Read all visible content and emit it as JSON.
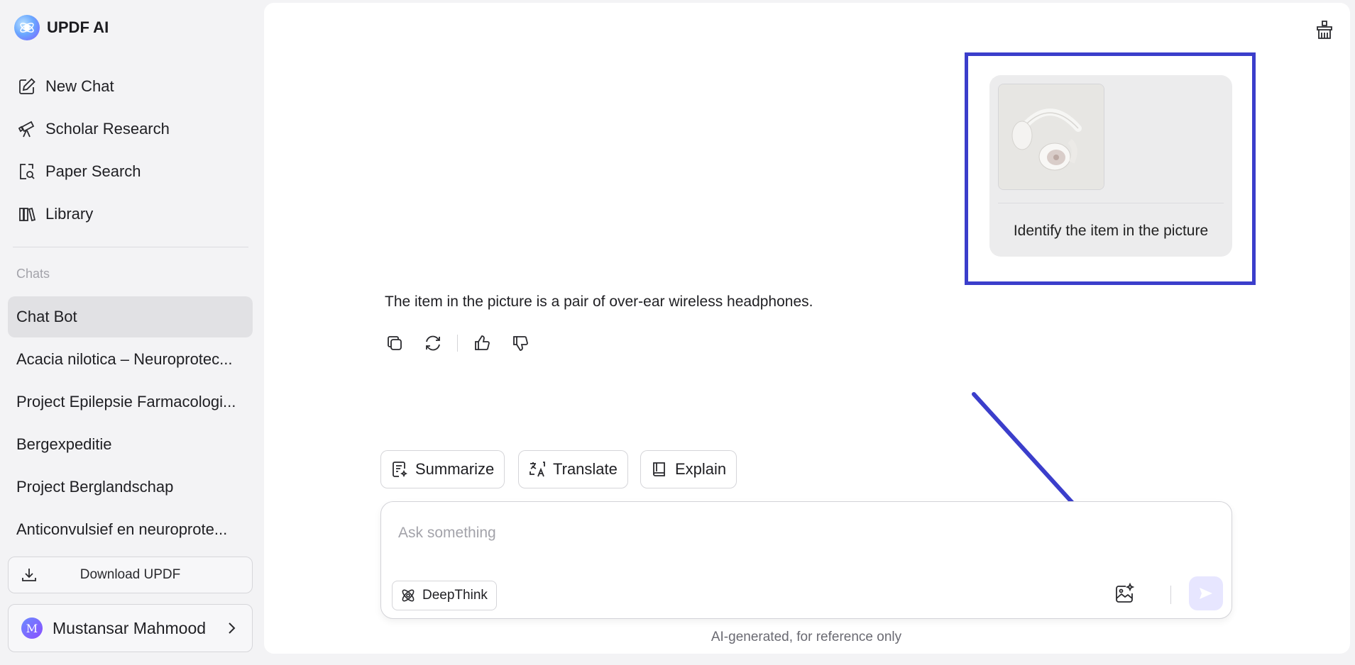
{
  "brand": {
    "name": "UPDF AI"
  },
  "sidebar": {
    "nav": [
      {
        "label": "New Chat",
        "icon": "edit-icon"
      },
      {
        "label": "Scholar Research",
        "icon": "telescope-icon"
      },
      {
        "label": "Paper Search",
        "icon": "document-search-icon"
      },
      {
        "label": "Library",
        "icon": "library-icon"
      }
    ],
    "chats_label": "Chats",
    "chats": [
      {
        "label": "Chat Bot",
        "active": true
      },
      {
        "label": "Acacia nilotica – Neuroprotec...",
        "active": false
      },
      {
        "label": "Project Epilepsie Farmacologi...",
        "active": false
      },
      {
        "label": "Bergexpeditie",
        "active": false
      },
      {
        "label": "Project Berglandschap",
        "active": false
      },
      {
        "label": "Anticonvulsief en neuroprote...",
        "active": false
      }
    ],
    "download_label": "Download UPDF",
    "user": {
      "initial": "M",
      "name": "Mustansar Mahmood"
    }
  },
  "conversation": {
    "user_message": {
      "image_icon": "headphones-image",
      "text": "Identify the item in the picture"
    },
    "ai_message": {
      "text": "The item in the picture is a pair of over-ear wireless headphones.",
      "actions": [
        "copy-icon",
        "regenerate-icon",
        "thumbs-up-icon",
        "thumbs-down-icon"
      ]
    }
  },
  "quick_actions": [
    {
      "label": "Summarize",
      "icon": "summarize-icon"
    },
    {
      "label": "Translate",
      "icon": "translate-icon"
    },
    {
      "label": "Explain",
      "icon": "book-icon"
    }
  ],
  "composer": {
    "placeholder": "Ask something",
    "deepthink_label": "DeepThink"
  },
  "disclaimer": "AI-generated, for reference only",
  "colors": {
    "annotation": "#3b3ecb",
    "send_button_bg": "#e7e6ff",
    "active_chat_bg": "#e1e1e4"
  }
}
